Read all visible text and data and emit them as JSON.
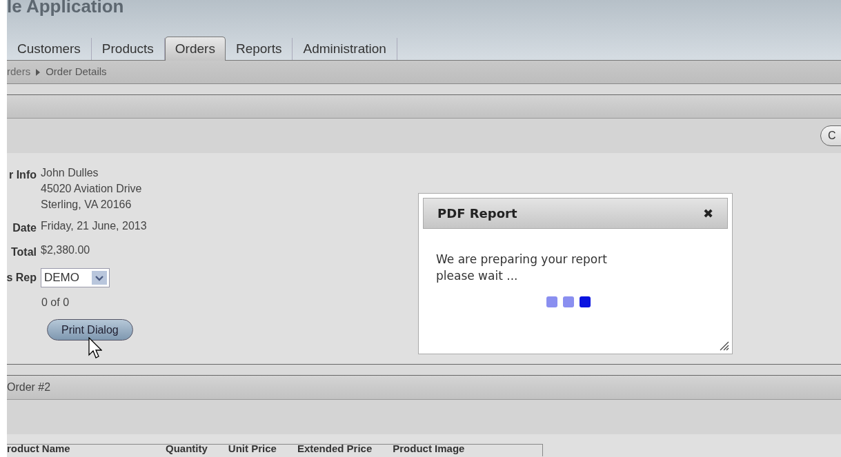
{
  "app_title": "le Application",
  "tabs": [
    {
      "label": "Customers",
      "selected": false
    },
    {
      "label": "Products",
      "selected": false
    },
    {
      "label": "Orders",
      "selected": true
    },
    {
      "label": "Reports",
      "selected": false
    },
    {
      "label": "Administration",
      "selected": false
    }
  ],
  "breadcrumb": [
    "rders",
    "Order Details"
  ],
  "toolbar_button": "C",
  "fields": [
    {
      "label": "r Info",
      "kind": "text",
      "lines": [
        "John Dulles",
        "45020 Aviation Drive",
        "Sterling, VA 20166"
      ]
    },
    {
      "label": "Date",
      "kind": "text",
      "lines": [
        "Friday, 21 June, 2013"
      ]
    },
    {
      "label": "Total",
      "kind": "text",
      "lines": [
        "$2,380.00"
      ]
    },
    {
      "label": "s Rep",
      "kind": "select",
      "value": "DEMO"
    }
  ],
  "pager": "0 of 0",
  "print_button": "Print Dialog",
  "dialog": {
    "title": "PDF Report",
    "close": "✖",
    "message": [
      "We are preparing your report",
      "please wait ..."
    ],
    "loader": [
      {
        "active": false
      },
      {
        "active": false
      },
      {
        "active": true
      }
    ]
  },
  "order_region": {
    "title": "Order #2"
  },
  "table": {
    "columns": [
      "roduct Name",
      "Quantity",
      "Unit Price",
      "Extended Price",
      "Product Image"
    ]
  }
}
